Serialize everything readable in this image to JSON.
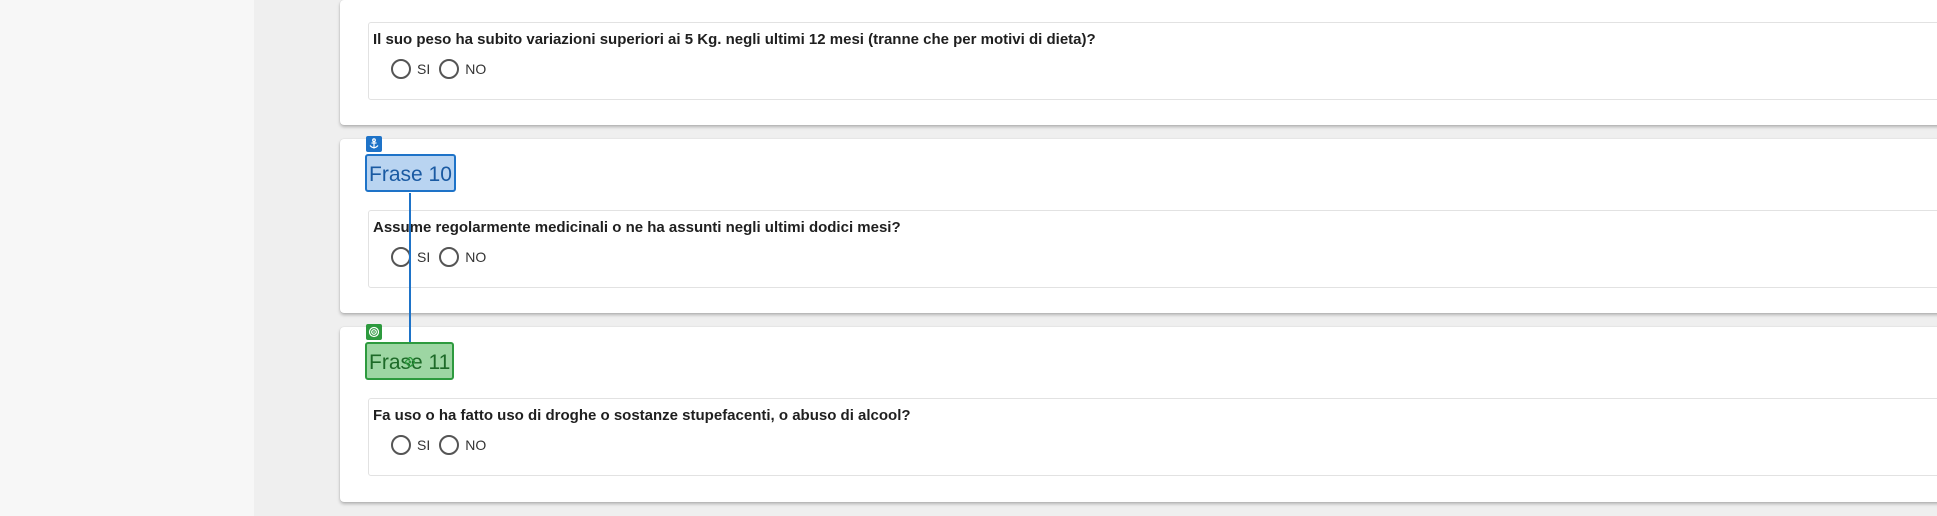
{
  "questions": [
    {
      "text": "Il suo peso ha subito variazioni superiori ai 5 Kg. negli ultimi 12 mesi (tranne che per motivi di dieta)?",
      "options": [
        "SI",
        "NO"
      ]
    },
    {
      "text": "Assume regolarmente medicinali o ne ha assunti negli ultimi dodici mesi?",
      "options": [
        "SI",
        "NO"
      ],
      "tag": "Frase 10",
      "tag_icon": "anchor-icon"
    },
    {
      "text": "Fa uso o ha fatto uso di droghe o sostanze stupefacenti, o abuso di alcool?",
      "options": [
        "SI",
        "NO"
      ],
      "tag": "Frase 11",
      "tag_icon": "target-icon"
    }
  ],
  "colors": {
    "tag_blue": "#1e73c8",
    "tag_green": "#2d9a3e"
  }
}
